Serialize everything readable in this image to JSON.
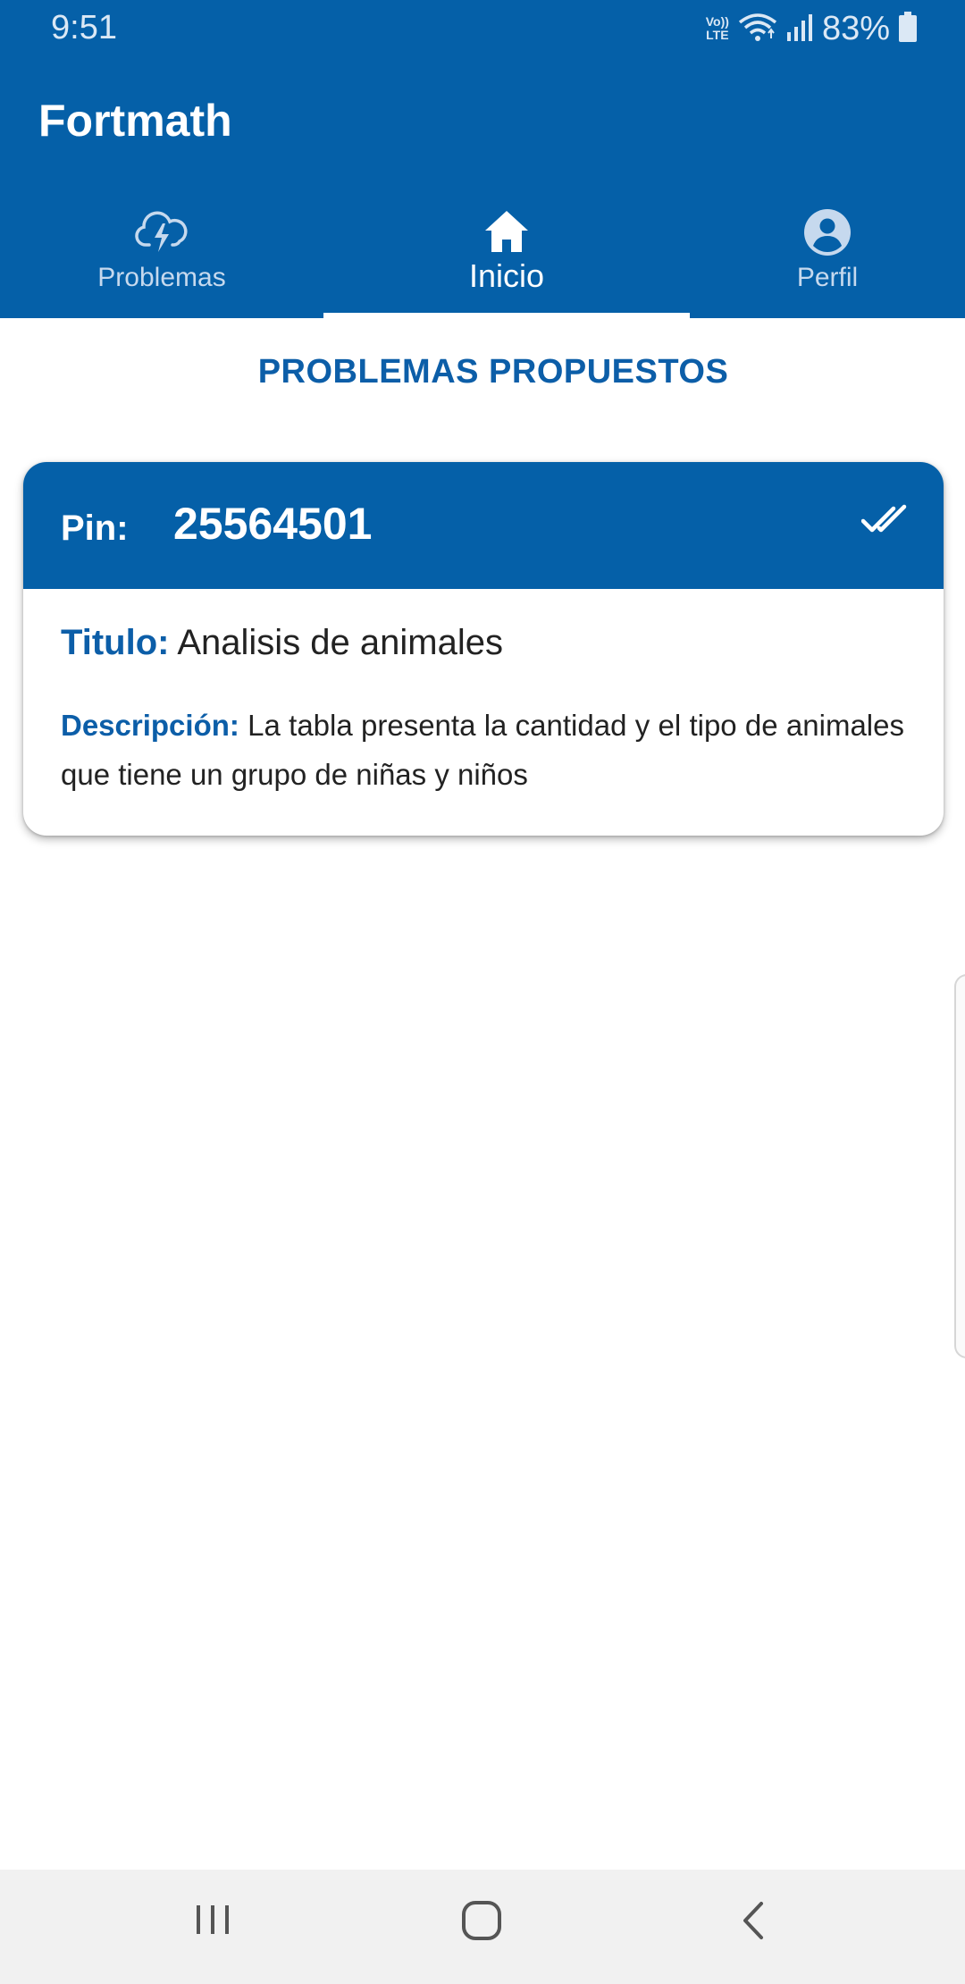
{
  "status_bar": {
    "time": "9:51",
    "volte_top": "Vo))",
    "volte_bottom": "LTE",
    "battery": "83%"
  },
  "app": {
    "title": "Fortmath"
  },
  "tabs": [
    {
      "label": "Problemas",
      "icon": "cloud-bolt-icon",
      "active": false
    },
    {
      "label": "Inicio",
      "icon": "home-icon",
      "active": true
    },
    {
      "label": "Perfil",
      "icon": "account-circle-icon",
      "active": false
    }
  ],
  "main": {
    "section_title": "PROBLEMAS PROPUESTOS",
    "problem_card": {
      "pin_label": "Pin:",
      "pin_value": "25564501",
      "status_icon": "done-all-icon",
      "title_label": "Titulo:",
      "title_value": "Analisis de animales",
      "description_label": "Descripción:",
      "description_value": "La tabla presenta la cantidad y el tipo de animales que tiene un grupo de niñas y niños"
    }
  },
  "nav_bar": {
    "buttons": [
      "recent-apps-icon",
      "home-button-icon",
      "back-icon"
    ]
  },
  "colors": {
    "primary": "#0560a8",
    "accent_text": "#0c5ea8",
    "navbar_bg": "#f1f1f1"
  }
}
